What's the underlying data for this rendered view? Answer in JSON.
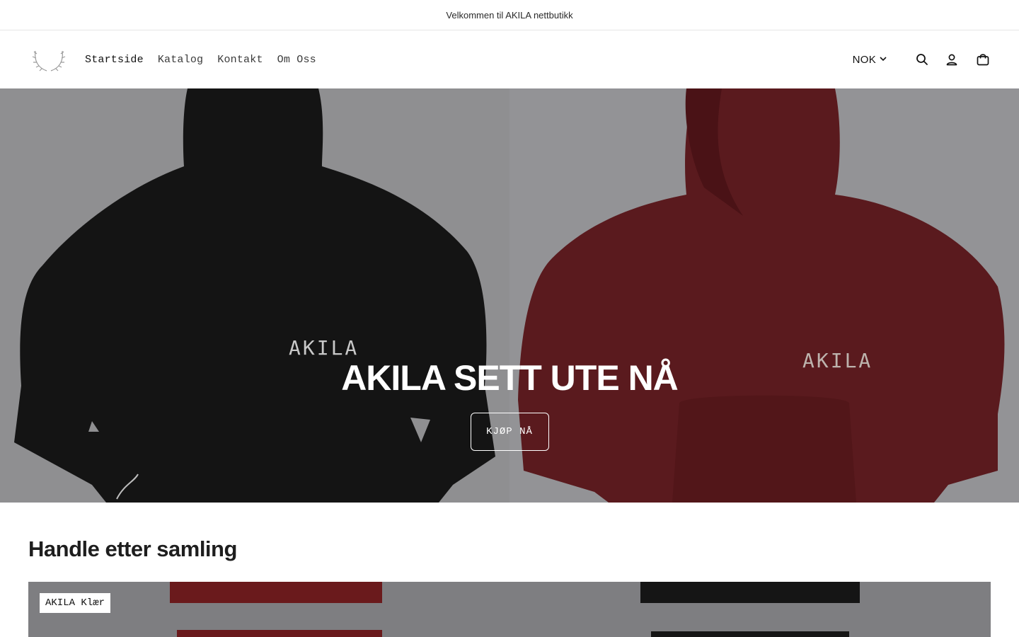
{
  "announcement": {
    "text": "Velkommen til AKILA nettbutikk"
  },
  "header": {
    "logo_icon": "laurel-wreath-icon",
    "nav": [
      {
        "label": "Startside",
        "active": true
      },
      {
        "label": "Katalog",
        "active": false
      },
      {
        "label": "Kontakt",
        "active": false
      },
      {
        "label": "Om Oss",
        "active": false
      }
    ],
    "currency": "NOK",
    "icons": [
      "search-icon",
      "account-icon",
      "cart-icon"
    ]
  },
  "hero": {
    "title": "AKILA SETT UTE NÅ",
    "button_label": "KJØP NÅ",
    "left_print": "AKILA",
    "right_print": "AKILA",
    "colors": {
      "black_hoodie": "#141414",
      "red_hoodie": "#5a1a1e",
      "overlay_text": "#ffffff"
    }
  },
  "collections": {
    "heading": "Handle etter samling",
    "items": [
      {
        "label": "AKILA Klær"
      }
    ]
  }
}
